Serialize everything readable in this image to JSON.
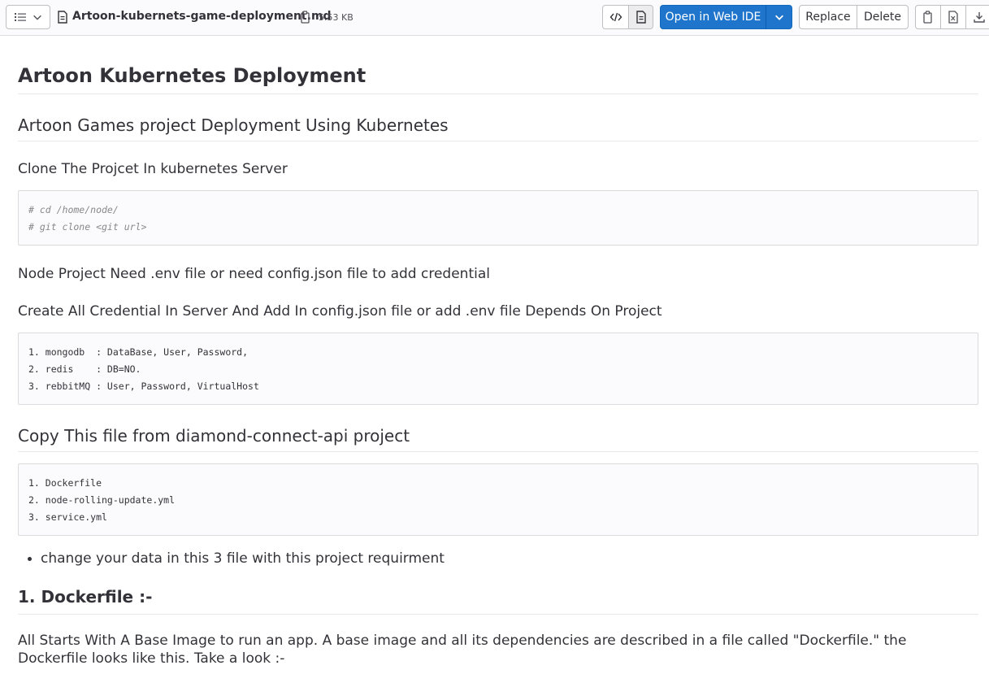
{
  "toolbar": {
    "filename": "Artoon-kubernets-game-deployment.md",
    "filesize": "5.53 KB",
    "open_ide_label": "Open in Web IDE",
    "replace_label": "Replace",
    "delete_label": "Delete",
    "accent_color": "#1f75cb"
  },
  "doc": {
    "h1": "Artoon Kubernetes Deployment",
    "h2_project": "Artoon Games project Deployment Using Kubernetes",
    "h3_clone": "Clone The Projcet In kubernetes Server",
    "code_clone": [
      "# cd /home/node/",
      "# git clone <git url>"
    ],
    "h3_env": "Node Project Need .env file or need config.json file to add credential",
    "h3_credentials": "Create All Credential In Server And Add In config.json file or add .env file Depends On Project",
    "code_credentials": [
      "1. mongodb  : DataBase, User, Password,",
      "2. redis    : DB=NO.",
      "3. rebbitMQ : User, Password, VirtualHost"
    ],
    "h2_copy": "Copy This file from diamond-connect-api project",
    "code_files": [
      "1. Dockerfile",
      "2. node-rolling-update.yml",
      "3. service.yml"
    ],
    "bullet_change": "change your data in this 3 file with this project requirment",
    "h3_dockerfile": "1. Dockerfile :-",
    "p_base_image": "All Starts With A Base Image to run an app. A base image and all its dependencies are described in a file called \"Dockerfile.\" the Dockerfile looks like this. Take a look :-"
  }
}
